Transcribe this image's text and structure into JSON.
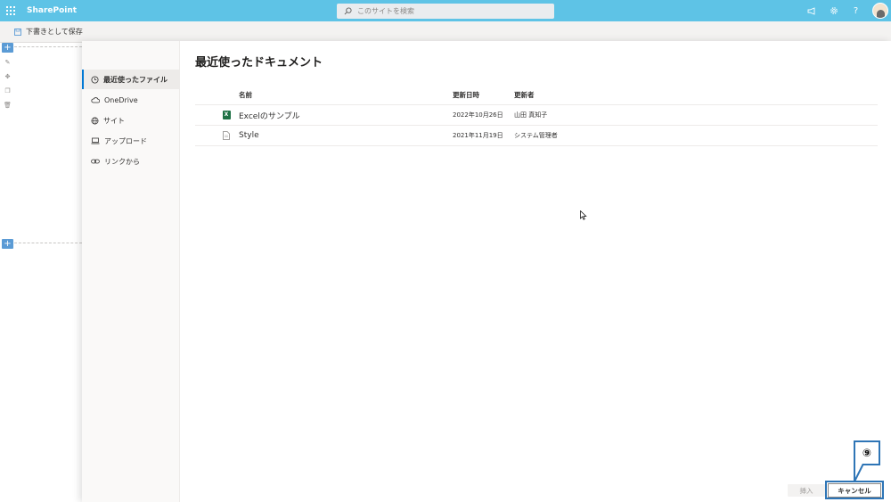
{
  "suitebar": {
    "brand": "SharePoint",
    "search_placeholder": "このサイトを検索",
    "icons": [
      "app-launcher-icon",
      "megaphone-icon",
      "gear-icon",
      "help-icon",
      "avatar"
    ]
  },
  "commandbar": {
    "save_draft_label": "下書きとして保存"
  },
  "panel": {
    "title": "最近使ったドキュメント",
    "nav": [
      {
        "label": "最近使ったファイル",
        "icon": "clock-icon",
        "active": true
      },
      {
        "label": "OneDrive",
        "icon": "cloud-icon",
        "active": false
      },
      {
        "label": "サイト",
        "icon": "globe-icon",
        "active": false
      },
      {
        "label": "アップロード",
        "icon": "laptop-icon",
        "active": false
      },
      {
        "label": "リンクから",
        "icon": "link-icon",
        "active": false
      }
    ],
    "table": {
      "headers": {
        "name": "名前",
        "modified": "更新日時",
        "modified_by": "更新者"
      },
      "rows": [
        {
          "icon": "excel-file-icon",
          "name": "Excelのサンプル",
          "modified": "2022年10月26日",
          "modified_by": "山田 真知子"
        },
        {
          "icon": "document-file-icon",
          "name": "Style",
          "modified": "2021年11月19日",
          "modified_by": "システム管理者"
        }
      ]
    },
    "footer": {
      "insert_label": "挿入",
      "cancel_label": "キャンセル"
    }
  },
  "annotation": {
    "step_marker": "⑨"
  },
  "colors": {
    "suitebar": "#5ec3e6",
    "accent": "#0078d4",
    "callout": "#2e75b6",
    "excel": "#1e7145"
  }
}
